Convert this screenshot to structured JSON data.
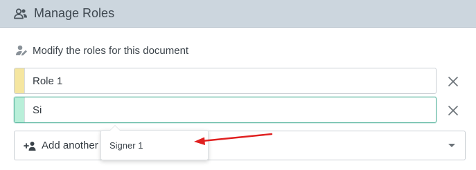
{
  "header": {
    "title": "Manage Roles",
    "icon": "users-icon"
  },
  "subtitle": {
    "text": "Modify the roles for this document",
    "icon": "user-edit-icon"
  },
  "roles": [
    {
      "value": "Role 1",
      "color": "#f5e6a0",
      "remove_icon": "close-icon"
    },
    {
      "value": "Si",
      "color": "#b9efd9",
      "remove_icon": "close-icon"
    }
  ],
  "add_role": {
    "label": "Add another",
    "icon": "user-plus-icon",
    "caret_icon": "caret-down-icon"
  },
  "dropdown": {
    "options": [
      "Signer 1"
    ]
  },
  "annotation": {
    "color": "#e02020",
    "icon": "red-arrow"
  },
  "colors": {
    "header_bg": "#ccd6de",
    "focus_border": "#5fb8a2"
  }
}
